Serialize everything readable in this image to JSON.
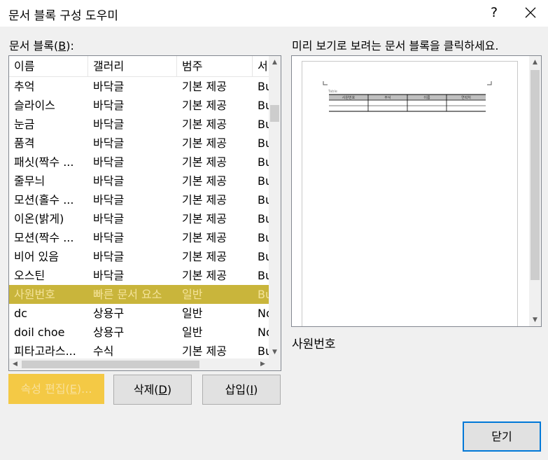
{
  "window": {
    "title": "문서 블록 구성 도우미",
    "help": "?"
  },
  "list": {
    "label_prefix": "문서 블록(",
    "label_key": "B",
    "label_suffix": "):",
    "columns": [
      "이름",
      "갤러리",
      "범주",
      "서"
    ],
    "rows": [
      {
        "name": "추억",
        "gallery": "바닥글",
        "category": "기본 제공",
        "template": "Bu"
      },
      {
        "name": "슬라이스",
        "gallery": "바닥글",
        "category": "기본 제공",
        "template": "Bu"
      },
      {
        "name": "눈금",
        "gallery": "바닥글",
        "category": "기본 제공",
        "template": "Bu"
      },
      {
        "name": "품격",
        "gallery": "바닥글",
        "category": "기본 제공",
        "template": "Bu"
      },
      {
        "name": "패싯(짝수 ...",
        "gallery": "바닥글",
        "category": "기본 제공",
        "template": "Bu"
      },
      {
        "name": "줄무늬",
        "gallery": "바닥글",
        "category": "기본 제공",
        "template": "Bu"
      },
      {
        "name": "모션(홀수 ...",
        "gallery": "바닥글",
        "category": "기본 제공",
        "template": "Bu"
      },
      {
        "name": "이온(밝게)",
        "gallery": "바닥글",
        "category": "기본 제공",
        "template": "Bu"
      },
      {
        "name": "모션(짝수 ...",
        "gallery": "바닥글",
        "category": "기본 제공",
        "template": "Bu"
      },
      {
        "name": " 비어 있음",
        "gallery": "바닥글",
        "category": "기본 제공",
        "template": "Bu"
      },
      {
        "name": "오스틴",
        "gallery": "바닥글",
        "category": "기본 제공",
        "template": "Bu"
      },
      {
        "name": "사원번호",
        "gallery": "빠른 문서 요소",
        "category": "일반",
        "template": "Bu",
        "selected": true
      },
      {
        "name": "dc",
        "gallery": "상용구",
        "category": "일반",
        "template": "No"
      },
      {
        "name": "doil choe",
        "gallery": "상용구",
        "category": "일반",
        "template": "No"
      },
      {
        "name": "피타고라스...",
        "gallery": "수식",
        "category": "기본 제공",
        "template": "Bu"
      }
    ]
  },
  "preview": {
    "label": "미리 보기로 보려는 문서 블록을 클릭하세요.",
    "caption": "사원번호",
    "table_caption": "Table",
    "table_headers": [
      "사원번호",
      "부서",
      "이름",
      "연락처"
    ]
  },
  "buttons": {
    "edit": {
      "prefix": "속성 편집(",
      "key": "E",
      "suffix": ")..."
    },
    "delete": {
      "prefix": "삭제(",
      "key": "D",
      "suffix": ")"
    },
    "insert": {
      "prefix": "삽입(",
      "key": "I",
      "suffix": ")"
    },
    "close": "닫기"
  },
  "colors": {
    "selection": "#c9b53b",
    "selection_text": "#f4e39a",
    "edit_button": "#f4c945",
    "default_button_border": "#0078d7"
  }
}
